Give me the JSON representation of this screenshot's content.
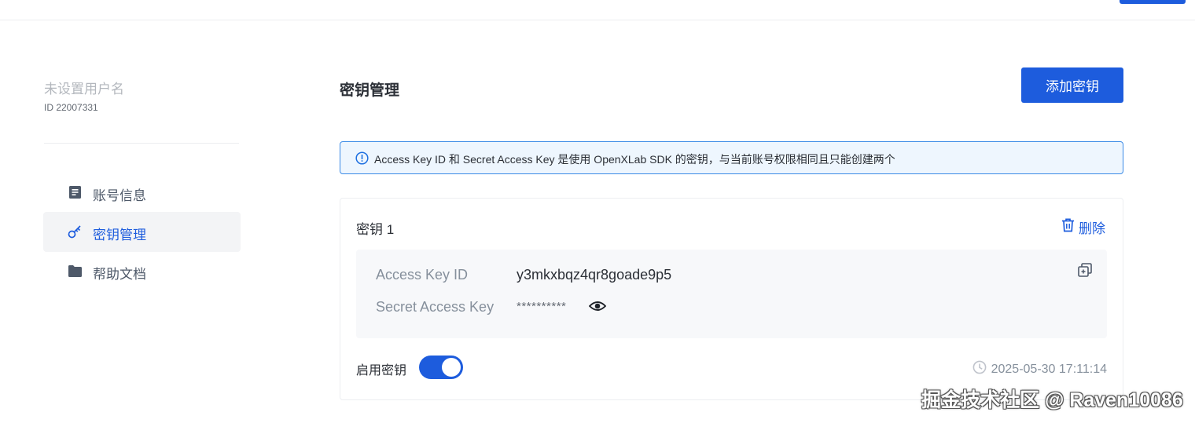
{
  "user": {
    "name_placeholder": "未设置用户名",
    "id_text": "ID 22007331"
  },
  "sidebar": {
    "items": [
      {
        "label": "账号信息",
        "icon": "document-icon",
        "active": false
      },
      {
        "label": "密钥管理",
        "icon": "key-icon",
        "active": true
      },
      {
        "label": "帮助文档",
        "icon": "folder-icon",
        "active": false
      }
    ]
  },
  "main": {
    "title": "密钥管理",
    "add_button_label": "添加密钥",
    "alert_text": "Access Key ID 和 Secret Access Key 是使用 OpenXLab SDK 的密钥，与当前账号权限相同且只能创建两个",
    "alert_icon": "info-circle-icon"
  },
  "key_card": {
    "title": "密钥 1",
    "delete_label": "删除",
    "access_key_id_label": "Access Key ID",
    "access_key_id_value": "y3mkxbqz4qr8goade9p5",
    "secret_key_label": "Secret Access Key",
    "secret_key_value": "**********",
    "enable_label": "启用密钥",
    "enabled": true,
    "created_at": "2025-05-30 17:11:14"
  },
  "watermark": "掘金技术社区 @ Raven10086",
  "colors": {
    "primary": "#1d5cdd",
    "alert_border": "#3a8ae6",
    "alert_bg": "#eef6fe",
    "panel_bg": "#f7f8fa",
    "active_nav_bg": "#f3f4f6"
  }
}
